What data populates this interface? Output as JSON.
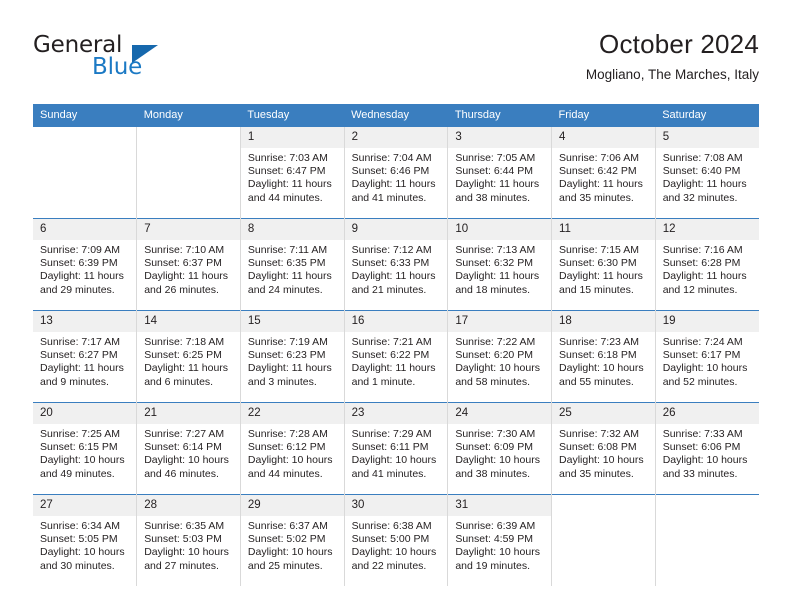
{
  "brand": {
    "name_part1": "General",
    "name_part2": "Blue",
    "logo_icon": "triangle-logo-icon"
  },
  "header": {
    "title": "October 2024",
    "location": "Mogliano, The Marches, Italy"
  },
  "calendar": {
    "weekday_headers": [
      "Sunday",
      "Monday",
      "Tuesday",
      "Wednesday",
      "Thursday",
      "Friday",
      "Saturday"
    ],
    "colors": {
      "header_bar": "#3a7ebf",
      "row_separator": "#3a7ebf",
      "date_strip": "#f0f0f0",
      "brand_blue": "#1b79c4",
      "text": "#231f20"
    },
    "weeks": [
      [
        {
          "date": "",
          "details": ""
        },
        {
          "date": "",
          "details": ""
        },
        {
          "date": "1",
          "details": "Sunrise: 7:03 AM\nSunset: 6:47 PM\nDaylight: 11 hours\nand 44 minutes."
        },
        {
          "date": "2",
          "details": "Sunrise: 7:04 AM\nSunset: 6:46 PM\nDaylight: 11 hours\nand 41 minutes."
        },
        {
          "date": "3",
          "details": "Sunrise: 7:05 AM\nSunset: 6:44 PM\nDaylight: 11 hours\nand 38 minutes."
        },
        {
          "date": "4",
          "details": "Sunrise: 7:06 AM\nSunset: 6:42 PM\nDaylight: 11 hours\nand 35 minutes."
        },
        {
          "date": "5",
          "details": "Sunrise: 7:08 AM\nSunset: 6:40 PM\nDaylight: 11 hours\nand 32 minutes."
        }
      ],
      [
        {
          "date": "6",
          "details": "Sunrise: 7:09 AM\nSunset: 6:39 PM\nDaylight: 11 hours\nand 29 minutes."
        },
        {
          "date": "7",
          "details": "Sunrise: 7:10 AM\nSunset: 6:37 PM\nDaylight: 11 hours\nand 26 minutes."
        },
        {
          "date": "8",
          "details": "Sunrise: 7:11 AM\nSunset: 6:35 PM\nDaylight: 11 hours\nand 24 minutes."
        },
        {
          "date": "9",
          "details": "Sunrise: 7:12 AM\nSunset: 6:33 PM\nDaylight: 11 hours\nand 21 minutes."
        },
        {
          "date": "10",
          "details": "Sunrise: 7:13 AM\nSunset: 6:32 PM\nDaylight: 11 hours\nand 18 minutes."
        },
        {
          "date": "11",
          "details": "Sunrise: 7:15 AM\nSunset: 6:30 PM\nDaylight: 11 hours\nand 15 minutes."
        },
        {
          "date": "12",
          "details": "Sunrise: 7:16 AM\nSunset: 6:28 PM\nDaylight: 11 hours\nand 12 minutes."
        }
      ],
      [
        {
          "date": "13",
          "details": "Sunrise: 7:17 AM\nSunset: 6:27 PM\nDaylight: 11 hours\nand 9 minutes."
        },
        {
          "date": "14",
          "details": "Sunrise: 7:18 AM\nSunset: 6:25 PM\nDaylight: 11 hours\nand 6 minutes."
        },
        {
          "date": "15",
          "details": "Sunrise: 7:19 AM\nSunset: 6:23 PM\nDaylight: 11 hours\nand 3 minutes."
        },
        {
          "date": "16",
          "details": "Sunrise: 7:21 AM\nSunset: 6:22 PM\nDaylight: 11 hours\nand 1 minute."
        },
        {
          "date": "17",
          "details": "Sunrise: 7:22 AM\nSunset: 6:20 PM\nDaylight: 10 hours\nand 58 minutes."
        },
        {
          "date": "18",
          "details": "Sunrise: 7:23 AM\nSunset: 6:18 PM\nDaylight: 10 hours\nand 55 minutes."
        },
        {
          "date": "19",
          "details": "Sunrise: 7:24 AM\nSunset: 6:17 PM\nDaylight: 10 hours\nand 52 minutes."
        }
      ],
      [
        {
          "date": "20",
          "details": "Sunrise: 7:25 AM\nSunset: 6:15 PM\nDaylight: 10 hours\nand 49 minutes."
        },
        {
          "date": "21",
          "details": "Sunrise: 7:27 AM\nSunset: 6:14 PM\nDaylight: 10 hours\nand 46 minutes."
        },
        {
          "date": "22",
          "details": "Sunrise: 7:28 AM\nSunset: 6:12 PM\nDaylight: 10 hours\nand 44 minutes."
        },
        {
          "date": "23",
          "details": "Sunrise: 7:29 AM\nSunset: 6:11 PM\nDaylight: 10 hours\nand 41 minutes."
        },
        {
          "date": "24",
          "details": "Sunrise: 7:30 AM\nSunset: 6:09 PM\nDaylight: 10 hours\nand 38 minutes."
        },
        {
          "date": "25",
          "details": "Sunrise: 7:32 AM\nSunset: 6:08 PM\nDaylight: 10 hours\nand 35 minutes."
        },
        {
          "date": "26",
          "details": "Sunrise: 7:33 AM\nSunset: 6:06 PM\nDaylight: 10 hours\nand 33 minutes."
        }
      ],
      [
        {
          "date": "27",
          "details": "Sunrise: 6:34 AM\nSunset: 5:05 PM\nDaylight: 10 hours\nand 30 minutes."
        },
        {
          "date": "28",
          "details": "Sunrise: 6:35 AM\nSunset: 5:03 PM\nDaylight: 10 hours\nand 27 minutes."
        },
        {
          "date": "29",
          "details": "Sunrise: 6:37 AM\nSunset: 5:02 PM\nDaylight: 10 hours\nand 25 minutes."
        },
        {
          "date": "30",
          "details": "Sunrise: 6:38 AM\nSunset: 5:00 PM\nDaylight: 10 hours\nand 22 minutes."
        },
        {
          "date": "31",
          "details": "Sunrise: 6:39 AM\nSunset: 4:59 PM\nDaylight: 10 hours\nand 19 minutes."
        },
        {
          "date": "",
          "details": ""
        },
        {
          "date": "",
          "details": ""
        }
      ]
    ]
  }
}
